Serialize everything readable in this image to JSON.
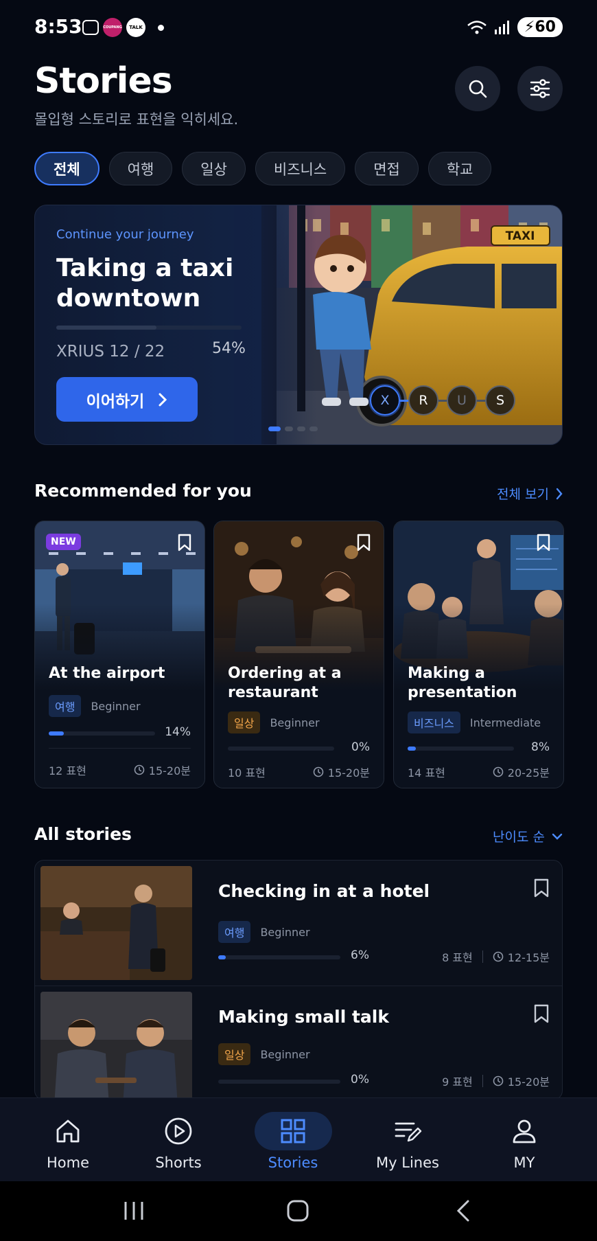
{
  "status": {
    "time": "8:53",
    "battery": "60",
    "talk_badge": "TALK",
    "app_badge": "COUPANG"
  },
  "header": {
    "title": "Stories",
    "subtitle": "몰입형 스토리로 표현을 익히세요."
  },
  "filters": [
    {
      "label": "전체",
      "active": true
    },
    {
      "label": "여행",
      "active": false
    },
    {
      "label": "일상",
      "active": false
    },
    {
      "label": "비즈니스",
      "active": false
    },
    {
      "label": "면접",
      "active": false
    },
    {
      "label": "학교",
      "active": false
    }
  ],
  "hero": {
    "kicker": "Continue your journey",
    "title": "Taking a taxi downtown",
    "lesson": "XRIUS 12 / 22",
    "progress_label": "54%",
    "progress": 0.54,
    "button": "이어하기",
    "steps": [
      "X",
      "R",
      "U",
      "S"
    ],
    "taxi_sign": "TAXI"
  },
  "recommended": {
    "title": "Recommended for you",
    "see_all": "전체 보기",
    "items": [
      {
        "badge": "NEW",
        "title": "At the airport",
        "tag": "여행",
        "level": "Beginner",
        "progress_label": "14%",
        "progress": 0.14,
        "count": "12 표현",
        "duration": "15-20분"
      },
      {
        "title": "Ordering at a restaurant",
        "tag": "일상",
        "level": "Beginner",
        "progress_label": "0%",
        "progress": 0,
        "count": "10 표현",
        "duration": "15-20분"
      },
      {
        "title": "Making a presentation",
        "tag": "비즈니스",
        "level": "Intermediate",
        "progress_label": "8%",
        "progress": 0.08,
        "count": "14 표현",
        "duration": "20-25분"
      }
    ]
  },
  "all_stories": {
    "title": "All stories",
    "sort": "난이도 순",
    "items": [
      {
        "title": "Checking in at a hotel",
        "tag": "여행",
        "level": "Beginner",
        "progress_label": "6%",
        "progress": 0.06,
        "count": "8 표현",
        "duration": "12-15분"
      },
      {
        "title": "Making small talk",
        "tag": "일상",
        "level": "Beginner",
        "progress_label": "0%",
        "progress": 0,
        "count": "9 표현",
        "duration": "15-20분"
      }
    ]
  },
  "tabs": [
    {
      "label": "Home",
      "icon": "home-icon"
    },
    {
      "label": "Shorts",
      "icon": "play-circle-icon"
    },
    {
      "label": "Stories",
      "icon": "grid-icon",
      "active": true
    },
    {
      "label": "My Lines",
      "icon": "notes-edit-icon"
    },
    {
      "label": "MY",
      "icon": "user-icon"
    }
  ],
  "colors": {
    "accent": "#3e7bff",
    "background": "#050913",
    "card": "#0b111d",
    "daily_tag": "#f2a54a"
  }
}
